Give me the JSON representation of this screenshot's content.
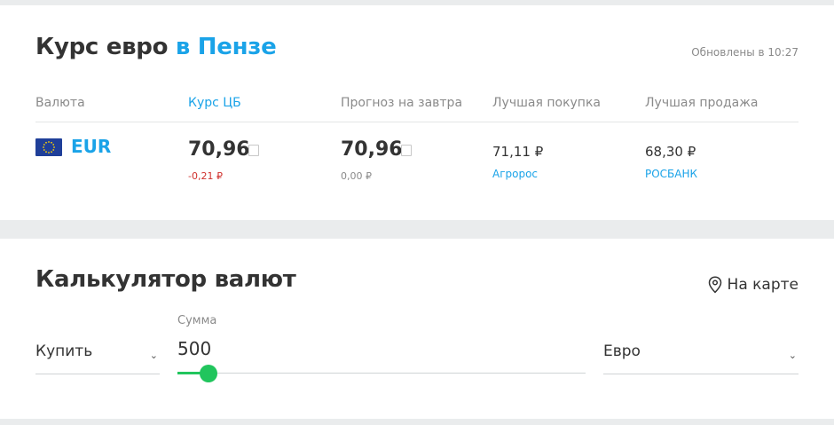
{
  "rates_card": {
    "title_main": "Курс евро",
    "title_accent": "в Пензе",
    "updated": "Обновлены в 10:27",
    "headers": {
      "currency": "Валюта",
      "cb": "Курс ЦБ",
      "forecast": "Прогноз на завтра",
      "best_buy": "Лучшая покупка",
      "best_sell": "Лучшая продажа"
    },
    "row": {
      "flag_icon": "eu-flag-icon",
      "code": "EUR",
      "cb_rate": "70,96",
      "cb_delta": "-0,21 ₽",
      "forecast_rate": "70,96",
      "forecast_delta": "0,00 ₽",
      "best_buy_value": "71,11 ₽",
      "best_buy_bank": "Агророс",
      "best_sell_value": "68,30 ₽",
      "best_sell_bank": "РОСБАНК"
    }
  },
  "calculator": {
    "title": "Калькулятор валют",
    "map_link": "На карте",
    "map_icon": "map-pin-icon",
    "operation": "Купить",
    "sum_label": "Сумма",
    "sum_value": "500",
    "slider_level": 0.077,
    "currency": "Евро"
  },
  "colors": {
    "accent": "#1aa3e8",
    "negative": "#d0312d",
    "slider": "#21c55d"
  }
}
